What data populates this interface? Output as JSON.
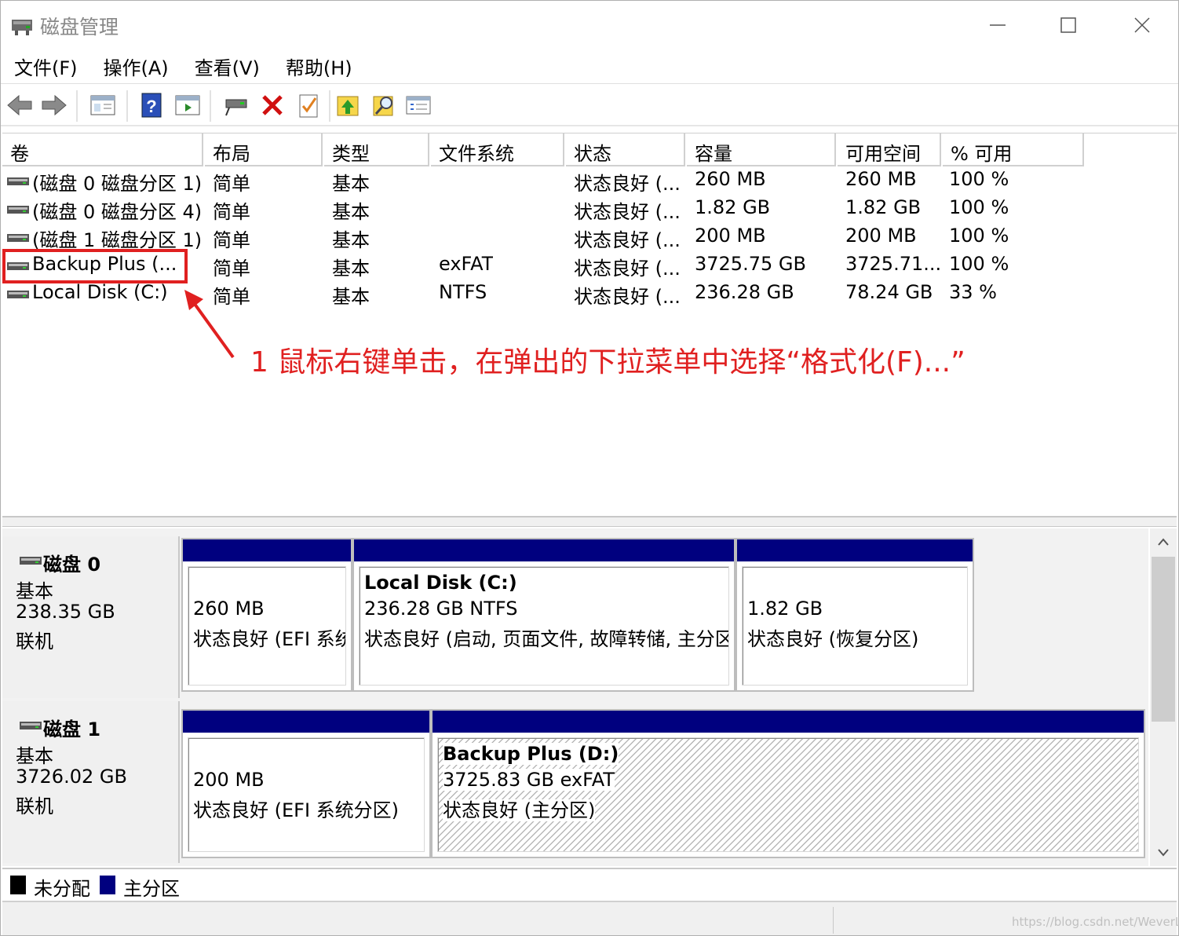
{
  "window": {
    "title": "磁盘管理",
    "menu": [
      "文件(F)",
      "操作(A)",
      "查看(V)",
      "帮助(H)"
    ]
  },
  "toolbar": {
    "icons": [
      "back-arrow-icon",
      "forward-arrow-icon",
      "console-tree-icon",
      "help-icon",
      "show-pane-icon",
      "connect-drive-icon",
      "delete-icon",
      "properties-icon",
      "export-icon",
      "search-icon",
      "details-icon"
    ]
  },
  "volumes": {
    "columns": [
      "卷",
      "布局",
      "类型",
      "文件系统",
      "状态",
      "容量",
      "可用空间",
      "% 可用"
    ],
    "rows": [
      {
        "name": "(磁盘 0 磁盘分区 1)",
        "layout": "简单",
        "type": "基本",
        "fs": "",
        "status": "状态良好 (...",
        "capacity": "260 MB",
        "free": "260 MB",
        "pct": "100 %"
      },
      {
        "name": "(磁盘 0 磁盘分区 4)",
        "layout": "简单",
        "type": "基本",
        "fs": "",
        "status": "状态良好 (...",
        "capacity": "1.82 GB",
        "free": "1.82 GB",
        "pct": "100 %"
      },
      {
        "name": "(磁盘 1 磁盘分区 1)",
        "layout": "简单",
        "type": "基本",
        "fs": "",
        "status": "状态良好 (...",
        "capacity": "200 MB",
        "free": "200 MB",
        "pct": "100 %"
      },
      {
        "name": "Backup Plus (...",
        "layout": "简单",
        "type": "基本",
        "fs": "exFAT",
        "status": "状态良好 (...",
        "capacity": "3725.75 GB",
        "free": "3725.71...",
        "pct": "100 %"
      },
      {
        "name": "Local Disk (C:)",
        "layout": "简单",
        "type": "基本",
        "fs": "NTFS",
        "status": "状态良好 (...",
        "capacity": "236.28 GB",
        "free": "78.24 GB",
        "pct": "33 %"
      }
    ]
  },
  "annotation": {
    "text": "1 鼠标右键单击，在弹出的下拉菜单中选择“格式化(F)...”",
    "color": "#e02020"
  },
  "disks": [
    {
      "name": "磁盘 0",
      "type": "基本",
      "size": "238.35 GB",
      "state": "联机",
      "partitions": [
        {
          "title": "",
          "lines": [
            "260 MB",
            "状态良好 (EFI 系统分区)"
          ]
        },
        {
          "title": "Local Disk  (C:)",
          "lines": [
            "236.28 GB NTFS",
            "状态良好 (启动, 页面文件, 故障转储, 主分区)"
          ]
        },
        {
          "title": "",
          "lines": [
            "1.82 GB",
            "状态良好 (恢复分区)"
          ]
        }
      ]
    },
    {
      "name": "磁盘 1",
      "type": "基本",
      "size": "3726.02 GB",
      "state": "联机",
      "partitions": [
        {
          "title": "",
          "lines": [
            "200 MB",
            "状态良好 (EFI 系统分区)"
          ]
        },
        {
          "title": "Backup Plus  (D:)",
          "lines": [
            "3725.83 GB exFAT",
            "状态良好 (主分区)"
          ]
        }
      ]
    }
  ],
  "legend": [
    {
      "label": "未分配",
      "color": "#000000"
    },
    {
      "label": "主分区",
      "color": "#00007f"
    }
  ],
  "statusbar": {
    "watermark": "https://blog.csdn.net/WeverLu"
  }
}
